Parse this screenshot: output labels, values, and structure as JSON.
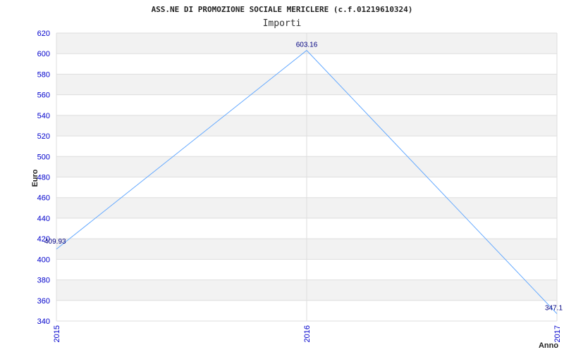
{
  "chart_data": {
    "type": "line",
    "title": "ASS.NE DI PROMOZIONE SOCIALE MERICLERE (c.f.01219610324)",
    "subtitle": "Importi",
    "xlabel": "Anno",
    "ylabel": "Euro",
    "categories": [
      "2015",
      "2016",
      "2017"
    ],
    "series": [
      {
        "values": [
          409.93,
          603.16,
          347.1
        ],
        "labels": [
          "409.93",
          "603.16",
          "347.1"
        ]
      }
    ],
    "ylim": [
      340,
      620
    ],
    "yticks": [
      340,
      360,
      380,
      400,
      420,
      440,
      460,
      480,
      500,
      520,
      540,
      560,
      580,
      600,
      620
    ],
    "grid": true,
    "line_color": "#66aaff",
    "band_color": "#f2f2f2"
  }
}
